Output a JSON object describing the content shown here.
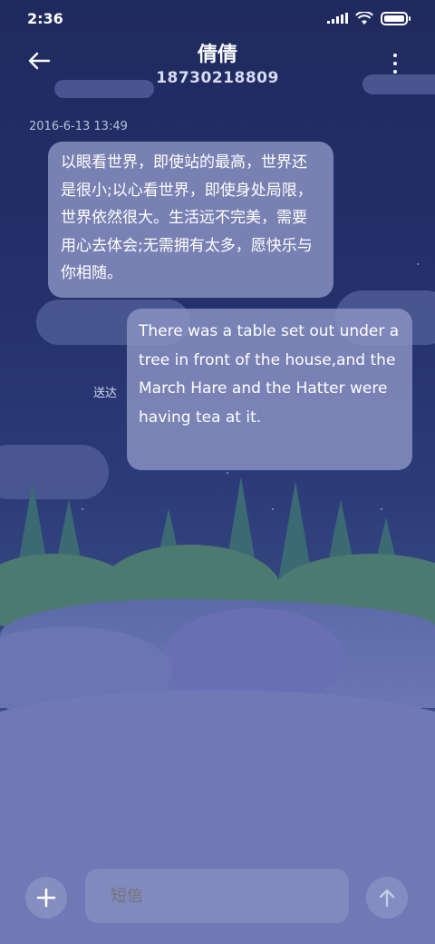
{
  "status_bar": {
    "time": "2:36"
  },
  "header": {
    "title": "倩倩",
    "subtitle": "18730218809"
  },
  "messages": [
    {
      "timestamp": "2016-6-13 13:49",
      "direction": "incoming",
      "text": "以眼看世界，即使站的最高，世界还是很小;以心看世界，即使身处局限，世界依然很大。生活远不完美，需要用心去体会;无需拥有太多，愿快乐与你相随。"
    },
    {
      "direction": "outgoing",
      "status": "送达",
      "text": "There was a table set out under a tree in front of the house,and the March Hare and the Hatter were having tea at it."
    }
  ],
  "composer": {
    "placeholder": "短信"
  },
  "icons": {
    "back": "back-arrow-icon",
    "more": "more-vertical-icon",
    "add": "plus-icon",
    "send": "send-arrow-icon"
  }
}
